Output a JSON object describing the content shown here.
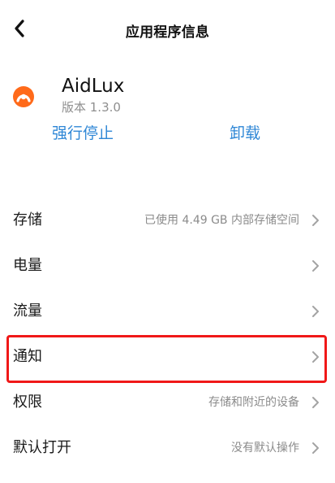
{
  "header": {
    "title": "应用程序信息",
    "back_icon": "chevron-left-icon"
  },
  "app": {
    "name": "AidLux",
    "version": "版本 1.3.0",
    "icon": "aidlux-app-icon",
    "icon_colors": {
      "primary": "#ff6a1a",
      "secondary": "#ffffff"
    }
  },
  "actions": {
    "force_stop_label": "强行停止",
    "uninstall_label": "卸载",
    "accent_color": "#2f87d6"
  },
  "settings": [
    {
      "label": "存储",
      "value": "已使用 4.49 GB 内部存储空间",
      "icon": "chevron-right-icon"
    },
    {
      "label": "电量",
      "value": "",
      "icon": "chevron-right-icon"
    },
    {
      "label": "流量",
      "value": "",
      "icon": "chevron-right-icon"
    },
    {
      "label": "通知",
      "value": "",
      "icon": "chevron-right-icon"
    },
    {
      "label": "权限",
      "value": "存储和附近的设备",
      "icon": "chevron-right-icon"
    },
    {
      "label": "默认打开",
      "value": "没有默认操作",
      "icon": "chevron-right-icon"
    }
  ],
  "highlight": {
    "target": "通知",
    "color": "#f01818"
  }
}
